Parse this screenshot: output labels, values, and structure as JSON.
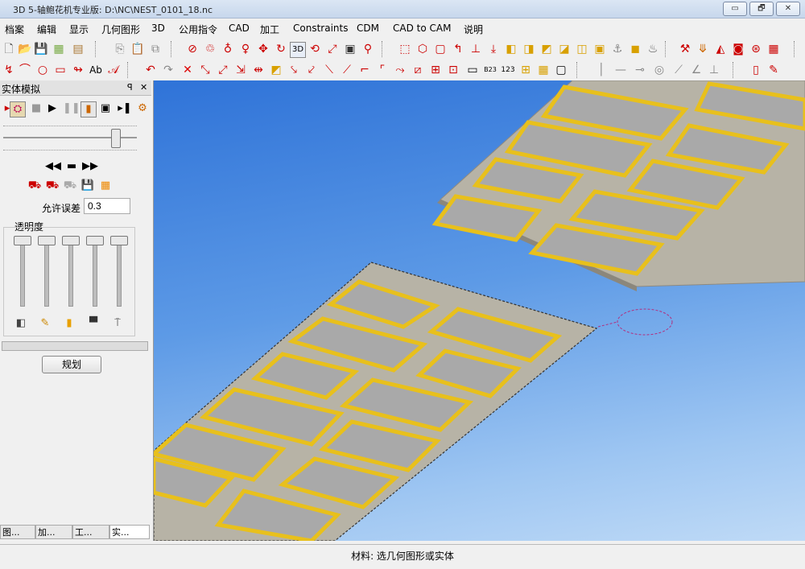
{
  "window": {
    "title": "3D 5-轴鲍花机专业版: D:\\NC\\NEST_0101_18.nc",
    "buttons": [
      "▭",
      "🗗",
      "✕"
    ]
  },
  "menu": [
    "档案",
    "编辑",
    "显示",
    "几何图形",
    "3D",
    "公用指令",
    "CAD",
    "加工",
    "Constraints",
    "CDM",
    "CAD to CAM",
    "说明"
  ],
  "toolbar1_icons": [
    "new-file",
    "open-file",
    "save",
    "print",
    "print-preview",
    "copy",
    "paste",
    "select-circle",
    "select-group",
    "select-user",
    "pan",
    "rotate-view",
    "3d-view",
    "3d-rotate",
    "zoom-fit",
    "image",
    "zoom-window",
    "box-view",
    "iso-view",
    "front-view",
    "axis-xy",
    "axis-z",
    "axis-origin",
    "cube-top",
    "cube-front",
    "cube-side",
    "cube-back",
    "cube-left",
    "cube-right",
    "cube-bottom",
    "anchor",
    "lathe",
    "tool-change",
    "drill",
    "solid-a",
    "solid-b",
    "record",
    "grid-view"
  ],
  "toolbar2_icons": [
    "polyline",
    "arc",
    "circle",
    "rectangle",
    "curve",
    "text",
    "text-style",
    "undo",
    "redo",
    "delete",
    "move",
    "copy-move",
    "scale",
    "mirror",
    "offset",
    "trim",
    "extend",
    "fillet",
    "chamfer",
    "break",
    "join",
    "corner",
    "explode",
    "array",
    "node-edit",
    "rect-tool",
    "number",
    "ab-text",
    "grid-snap",
    "frame",
    "line-h",
    "line-d",
    "circle-mark",
    "tangent",
    "angle",
    "dim-mark",
    "red-rect",
    "edit-pen"
  ],
  "panel": {
    "title": "实体模拟",
    "pin": "ꟼ",
    "close": "✕",
    "tolerance_label": "允许误差",
    "tolerance_value": "0.3",
    "transparency_label": "透明度",
    "plan_button": "规划",
    "tabs": [
      "图...",
      "加...",
      "工...",
      "实..."
    ]
  },
  "status": "材料: 选几何图形或实体",
  "colors": {
    "accent_yellow": "#e8c01c",
    "plate": "#b7b3a6",
    "pocket": "#a9a9a9",
    "viewport_top": "#2f73d8",
    "viewport_bottom": "#bfdaf6"
  }
}
